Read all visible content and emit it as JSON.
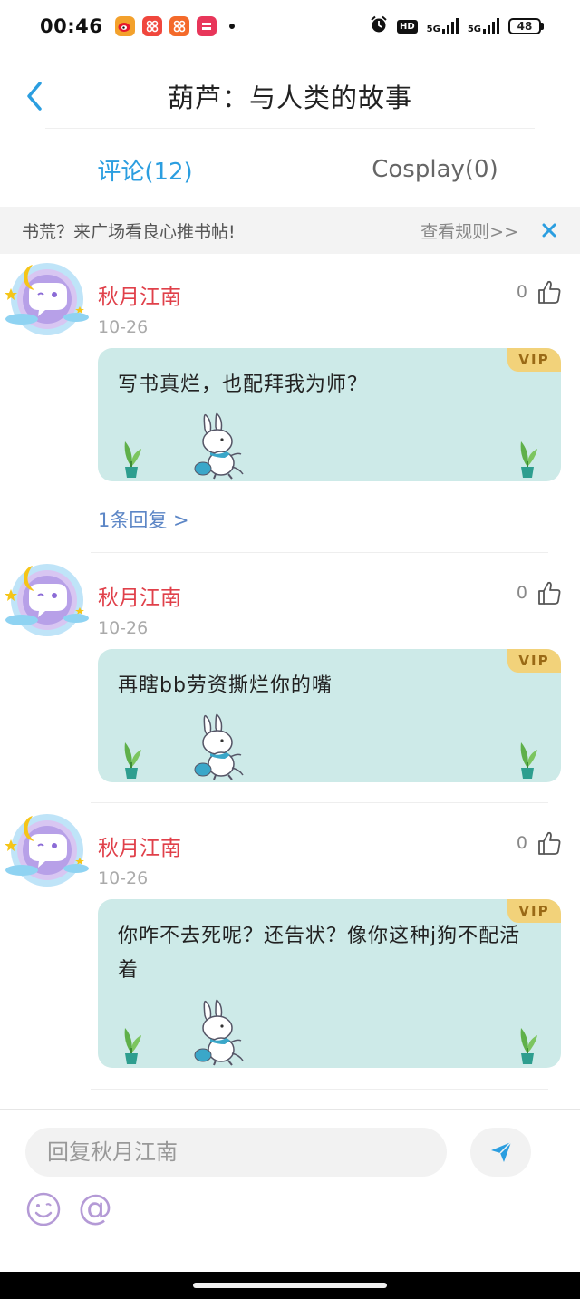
{
  "status_bar": {
    "time": "00:46",
    "app_icons": [
      "weibo-icon",
      "app-icon-red",
      "app-icon-orange",
      "app-icon-pink"
    ],
    "hd": "HD",
    "net1": "5G",
    "net2": "5G",
    "battery": "48"
  },
  "header": {
    "title": "葫芦：与人类的故事"
  },
  "tabs": [
    {
      "label": "评论(12)",
      "active": true
    },
    {
      "label": "Cosplay(0)",
      "active": false
    }
  ],
  "notice": {
    "text": "书荒？来广场看良心推书帖!",
    "link": "查看规则>>"
  },
  "comments": [
    {
      "name": "秋月江南",
      "date": "10-26",
      "likes": "0",
      "badge": "VIP",
      "text": "写书真烂，也配拜我为师？",
      "replies": "1条回复 >"
    },
    {
      "name": "秋月江南",
      "date": "10-26",
      "likes": "0",
      "badge": "VIP",
      "text": "再瞎bb劳资撕烂你的嘴"
    },
    {
      "name": "秋月江南",
      "date": "10-26",
      "likes": "0",
      "badge": "VIP",
      "text": "你咋不去死呢？还告状？像你这种j狗不配活着"
    }
  ],
  "reply_bar": {
    "placeholder": "回复秋月江南",
    "at_symbol": "@"
  },
  "colors": {
    "accent": "#2b9ee0",
    "username": "#e0404a",
    "bubble": "#cdeae8",
    "vip": "#f2d27a"
  }
}
